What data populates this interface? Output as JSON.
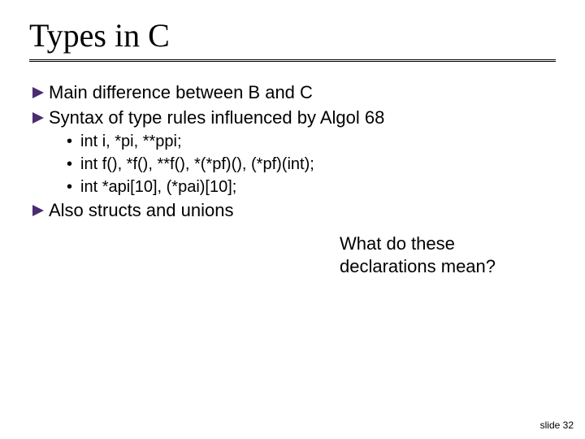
{
  "title": "Types in C",
  "bullets": {
    "b1": "Main difference between B and C",
    "b2": "Syntax of type rules influenced by Algol 68",
    "s1": "int i, *pi, **ppi;",
    "s2": "int f(), *f(), **f(), *(*pf)(), (*pf)(int);",
    "s3": "int *api[10], (*pai)[10];",
    "b3": "Also structs and unions"
  },
  "callout": {
    "line1": "What do these",
    "line2": "declarations mean?"
  },
  "footer": {
    "slide_label": "slide 32"
  },
  "icons": {
    "triangle_color": "#4b2c70"
  }
}
